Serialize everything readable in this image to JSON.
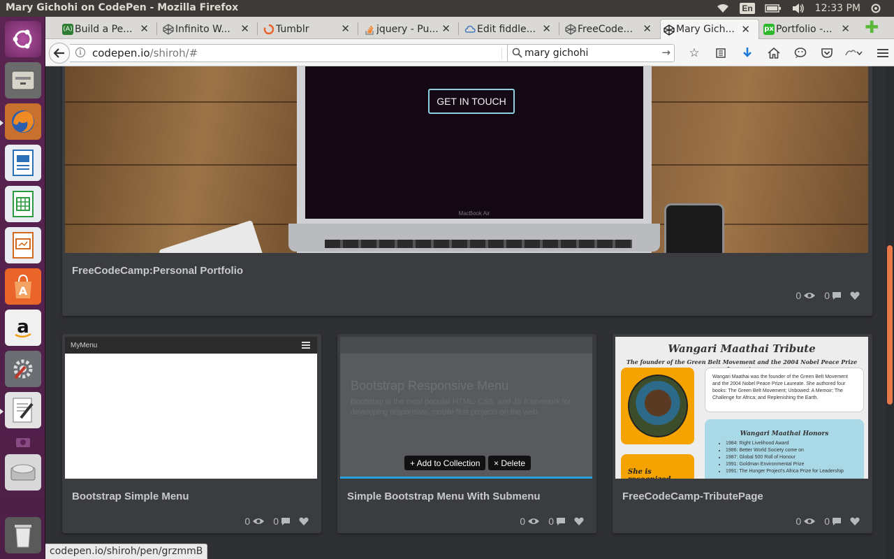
{
  "os_panel": {
    "window_title": "Mary Gichohi on CodePen - Mozilla Firefox",
    "keyboard_layout": "En",
    "clock": "12:33 PM"
  },
  "launcher": {
    "items": [
      "ubuntu-dash",
      "files",
      "firefox",
      "libreoffice-writer",
      "libreoffice-calc",
      "libreoffice-impress",
      "ubuntu-software",
      "amazon",
      "system-settings",
      "text-editor",
      "screenshot",
      "drive",
      "trash"
    ]
  },
  "browser": {
    "tabs": [
      {
        "label": "Build a Pe...",
        "icon": "freecodecamp-icon",
        "icon_color": "#2e7d32"
      },
      {
        "label": "Infinito W...",
        "icon": "codepen-icon",
        "icon_color": "#555555"
      },
      {
        "label": "Tumblr",
        "icon": "tumblr-spinner-icon",
        "icon_color": "#e8642c"
      },
      {
        "label": "jquery - Pu...",
        "icon": "stackoverflow-icon",
        "icon_color": "#f48024"
      },
      {
        "label": "Edit fiddle...",
        "icon": "jsfiddle-cloud-icon",
        "icon_color": "#4679bd"
      },
      {
        "label": "FreeCode...",
        "icon": "codepen-icon",
        "icon_color": "#555555"
      },
      {
        "label": "Mary Gich...",
        "icon": "codepen-icon",
        "icon_color": "#222222",
        "active": true
      },
      {
        "label": "Portfolio -...",
        "icon": "pixel-icon",
        "icon_color": "#2eb82e"
      }
    ],
    "url_domain": "codepen.io",
    "url_path": "/shiroh/#",
    "search_value": "mary gichohi",
    "status_url": "codepen.io/shiroh/pen/grzmmB"
  },
  "page": {
    "featured": {
      "cta_label": "GET IN TOUCH",
      "laptop_brand": "MacBook Air",
      "title": "FreeCodeCamp:Personal Portfolio",
      "views": "0",
      "comments": "0"
    },
    "pens": [
      {
        "title": "Bootstrap Simple Menu",
        "menu_label": "MyMenu",
        "views": "0",
        "comments": "0"
      },
      {
        "title": "Simple Bootstrap Menu With Submenu",
        "preview_heading": "Bootstrap Responsive Menu",
        "preview_text": "Bootstrap is the most popular HTML, CSS, and JS framework for developing responsive, mobile first projects on the web.",
        "add_label": "+ Add to Collection",
        "delete_label": "× Delete",
        "views": "0",
        "comments": "0"
      },
      {
        "title": "FreeCodeCamp-TributePage",
        "preview_title": "Wangari Maathai Tribute",
        "preview_subtitle": "The founder of the Green Belt Movement and the 2004 Nobel Peace Prize Laureate.",
        "preview_bio": "Wangari Maathai was the founder of the Green Belt Movement and the 2004 Nobel Peace Prize Laureate. She authored four books: The Green Belt Movement; Unbowed: A Memoir; The Challenge for Africa; and Replenishing the Earth.",
        "honors_title": "Wangari Maathai Honors",
        "honors": [
          "1984: Right Livelihood Award",
          "1986: Better World Society come on",
          "1987: Global 500 Roll of Honour",
          "1991: Goldman Environmental Prize",
          "1991: The Hunger Project's Africa Prize for Leadership"
        ],
        "recognized_text": "She is recognized",
        "views": "0",
        "comments": "0"
      }
    ]
  },
  "colors": {
    "page_bg": "#2f3033",
    "card_bg": "#3b3c40",
    "accent_scroll": "#e8784a",
    "launcher": "#5b2452"
  }
}
